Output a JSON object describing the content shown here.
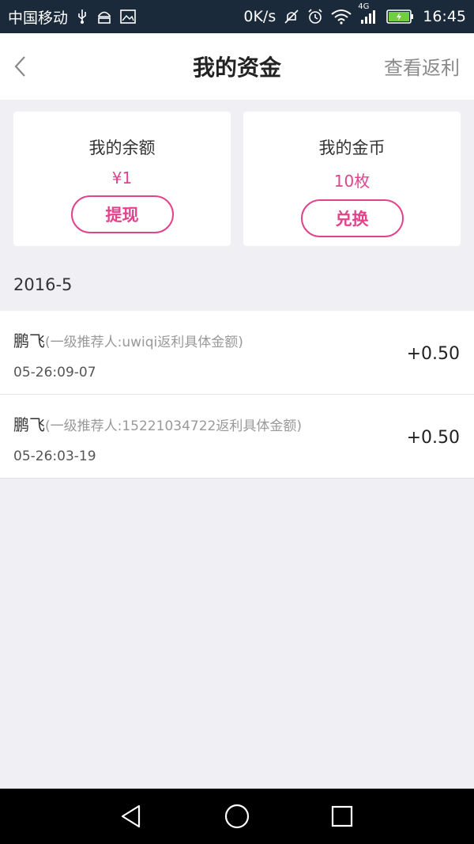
{
  "status_bar": {
    "carrier": "中国移动",
    "speed": "0K/s",
    "network": "4G",
    "time": "16:45",
    "icons": [
      "usb-icon",
      "android-icon",
      "image-icon",
      "mute-icon",
      "alarm-icon",
      "wifi-icon",
      "signal-icon",
      "battery-charging-icon"
    ]
  },
  "header": {
    "title": "我的资金",
    "right_link": "查看返利",
    "back_icon": "chevron-left-icon"
  },
  "cards": {
    "balance": {
      "label": "我的余额",
      "value": "¥1",
      "button": "提现"
    },
    "coins": {
      "label": "我的金币",
      "value": "10枚",
      "button": "兑换"
    }
  },
  "month": "2016-5",
  "records": [
    {
      "name": "鹏飞",
      "desc": "(一级推荐人:uwiqi返利具体金额)",
      "time": "05-26:09-07",
      "amount": "+0.50"
    },
    {
      "name": "鹏飞",
      "desc": "(一级推荐人:15221034722返利具体金额)",
      "time": "05-26:03-19",
      "amount": "+0.50"
    }
  ],
  "navigation": [
    "back-triangle-icon",
    "home-circle-icon",
    "recents-square-icon"
  ],
  "colors": {
    "accent": "#e0448c",
    "status_bar_bg": "#1b2a3a",
    "page_bg": "#efeff4"
  }
}
